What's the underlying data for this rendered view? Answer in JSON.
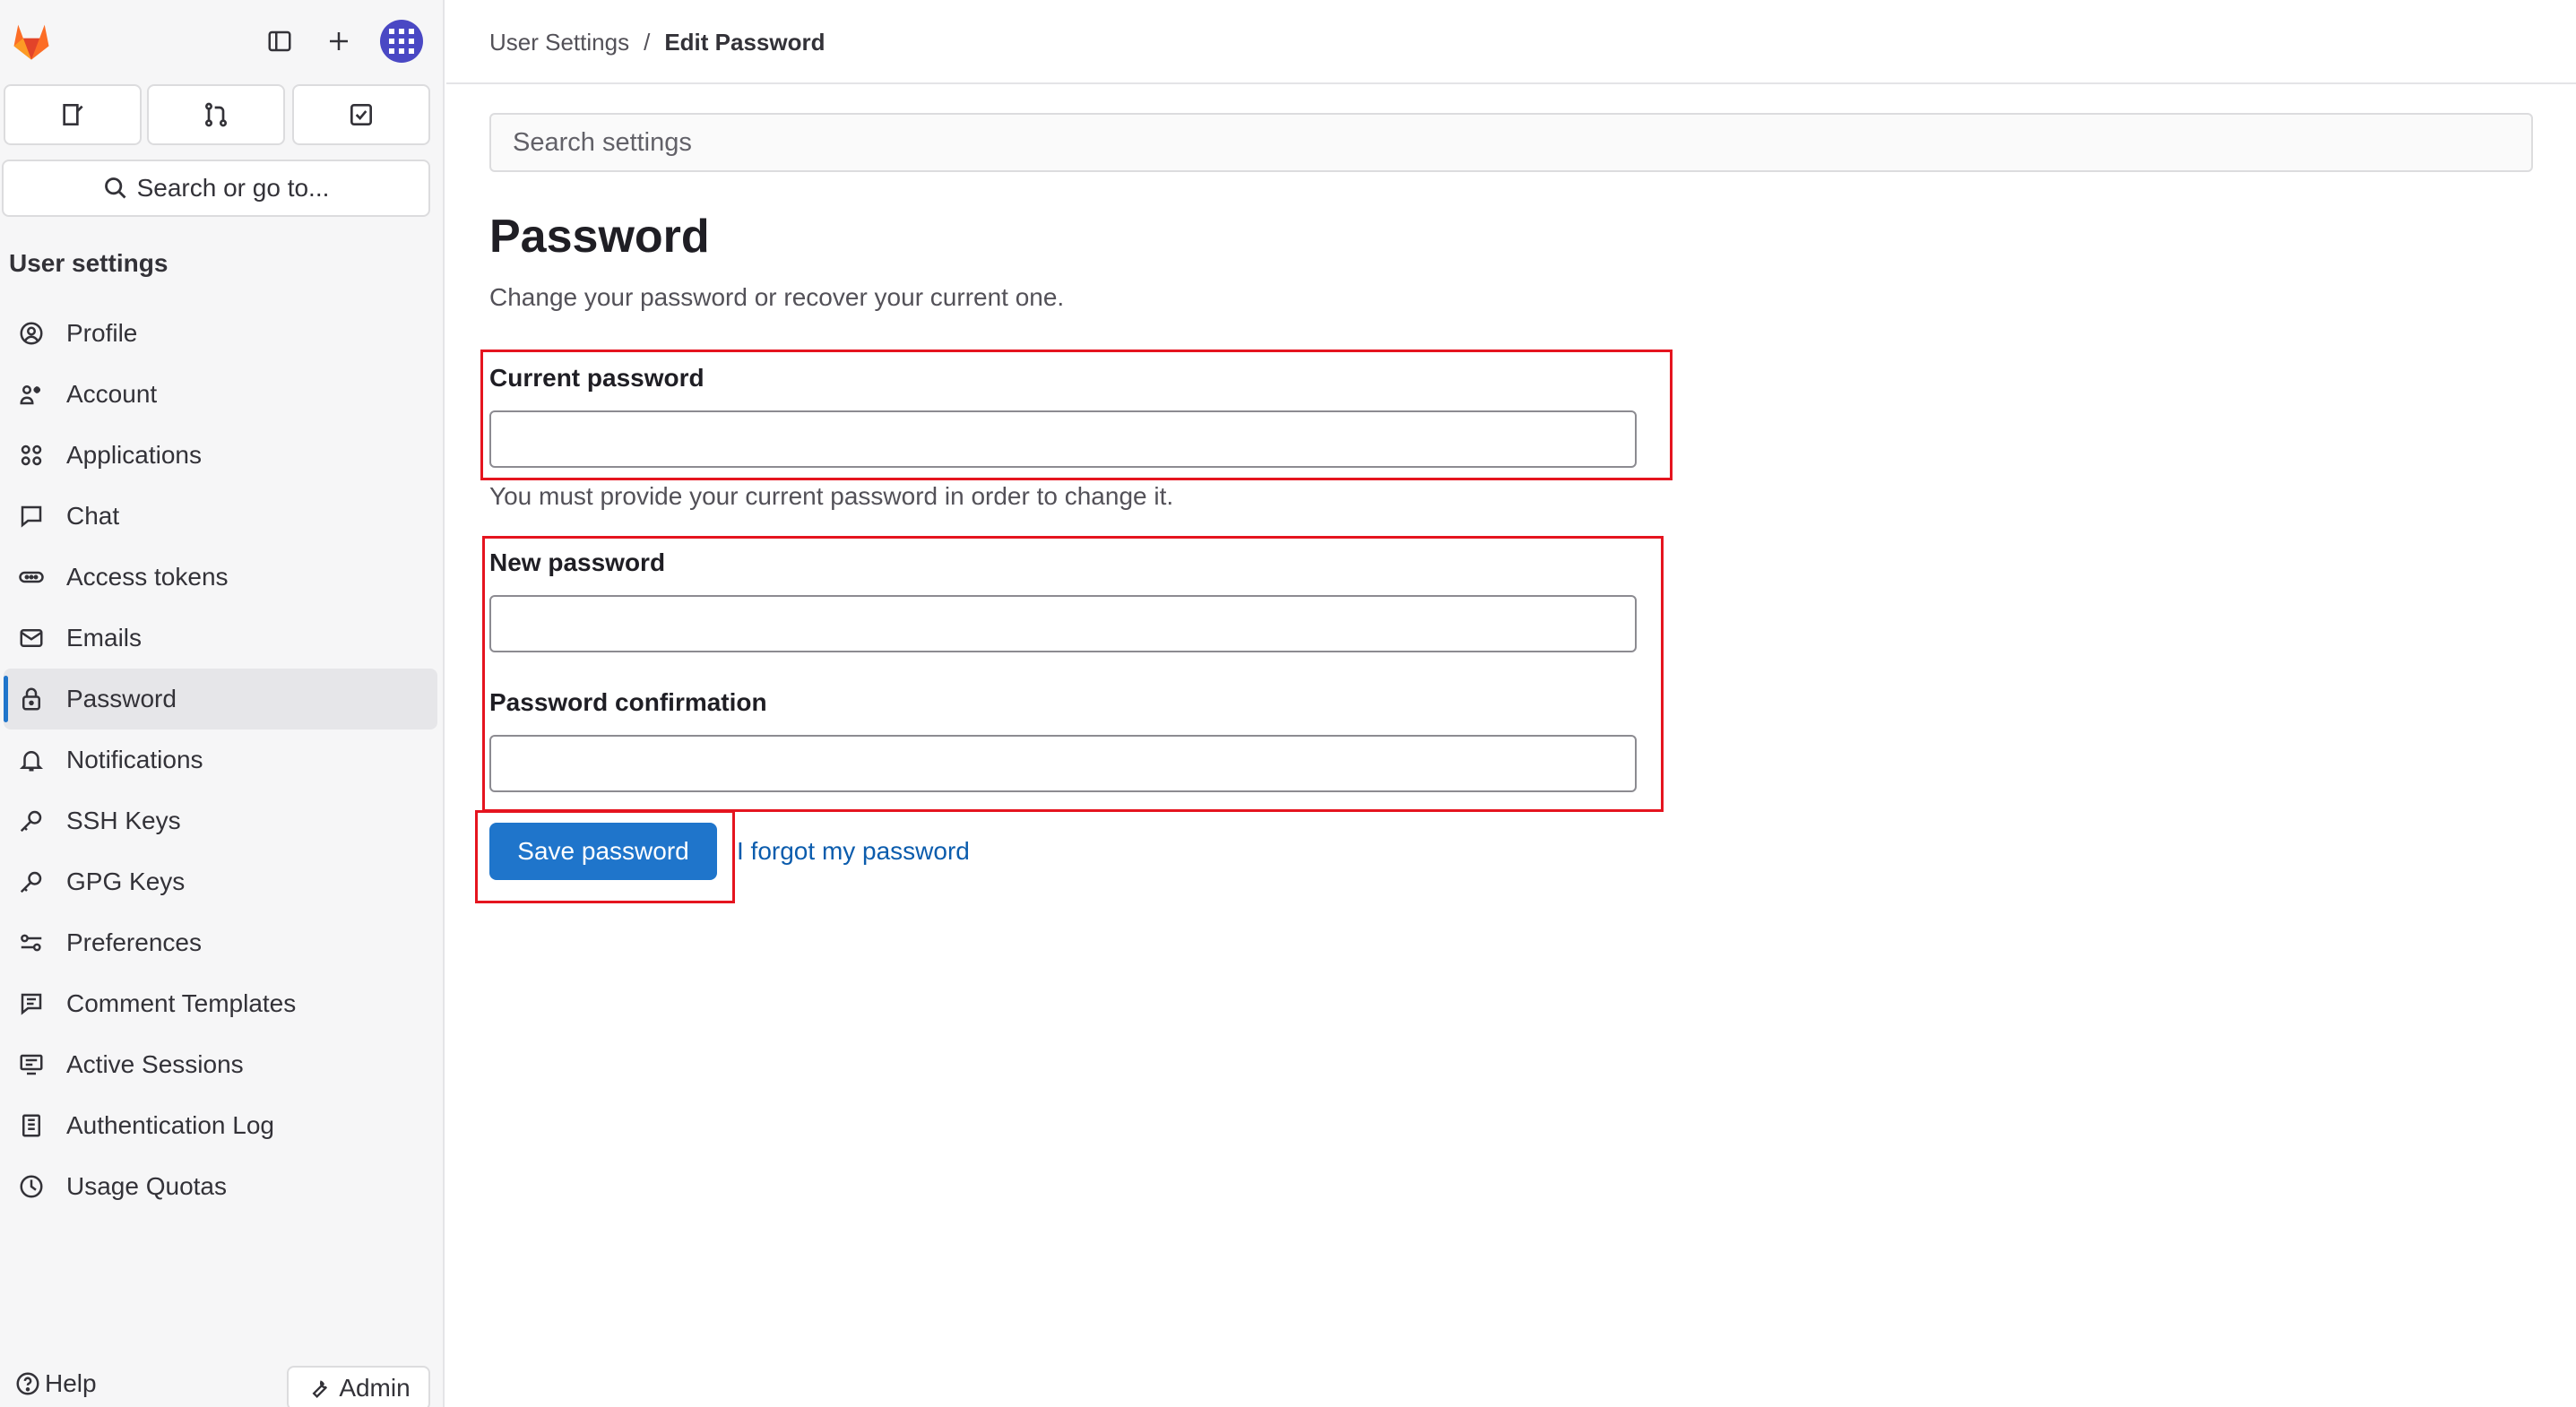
{
  "sidebar": {
    "search_label": "Search or go to...",
    "section_title": "User settings",
    "items": [
      {
        "label": "Profile",
        "icon": "profile-icon",
        "active": false
      },
      {
        "label": "Account",
        "icon": "account-icon",
        "active": false
      },
      {
        "label": "Applications",
        "icon": "applications-icon",
        "active": false
      },
      {
        "label": "Chat",
        "icon": "chat-icon",
        "active": false
      },
      {
        "label": "Access tokens",
        "icon": "token-icon",
        "active": false
      },
      {
        "label": "Emails",
        "icon": "mail-icon",
        "active": false
      },
      {
        "label": "Password",
        "icon": "lock-icon",
        "active": true
      },
      {
        "label": "Notifications",
        "icon": "bell-icon",
        "active": false
      },
      {
        "label": "SSH Keys",
        "icon": "key-icon",
        "active": false
      },
      {
        "label": "GPG Keys",
        "icon": "key-icon",
        "active": false
      },
      {
        "label": "Preferences",
        "icon": "preferences-icon",
        "active": false
      },
      {
        "label": "Comment Templates",
        "icon": "comment-icon",
        "active": false
      },
      {
        "label": "Active Sessions",
        "icon": "monitor-icon",
        "active": false
      },
      {
        "label": "Authentication Log",
        "icon": "log-icon",
        "active": false
      },
      {
        "label": "Usage Quotas",
        "icon": "quota-icon",
        "active": false
      }
    ],
    "help_label": "Help",
    "admin_label": "Admin"
  },
  "breadcrumb": {
    "parent": "User Settings",
    "separator": "/",
    "current": "Edit Password"
  },
  "main": {
    "search_placeholder": "Search settings",
    "title": "Password",
    "description": "Change your password or recover your current one.",
    "current_password_label": "Current password",
    "current_password_help": "You must provide your current password in order to change it.",
    "new_password_label": "New password",
    "confirm_password_label": "Password confirmation",
    "save_button": "Save password",
    "forgot_link": "I forgot my password"
  },
  "colors": {
    "accent": "#1f75cb",
    "link": "#0b5cad",
    "highlight": "#e5141f",
    "gitlab_orange": "#fc6d26"
  }
}
